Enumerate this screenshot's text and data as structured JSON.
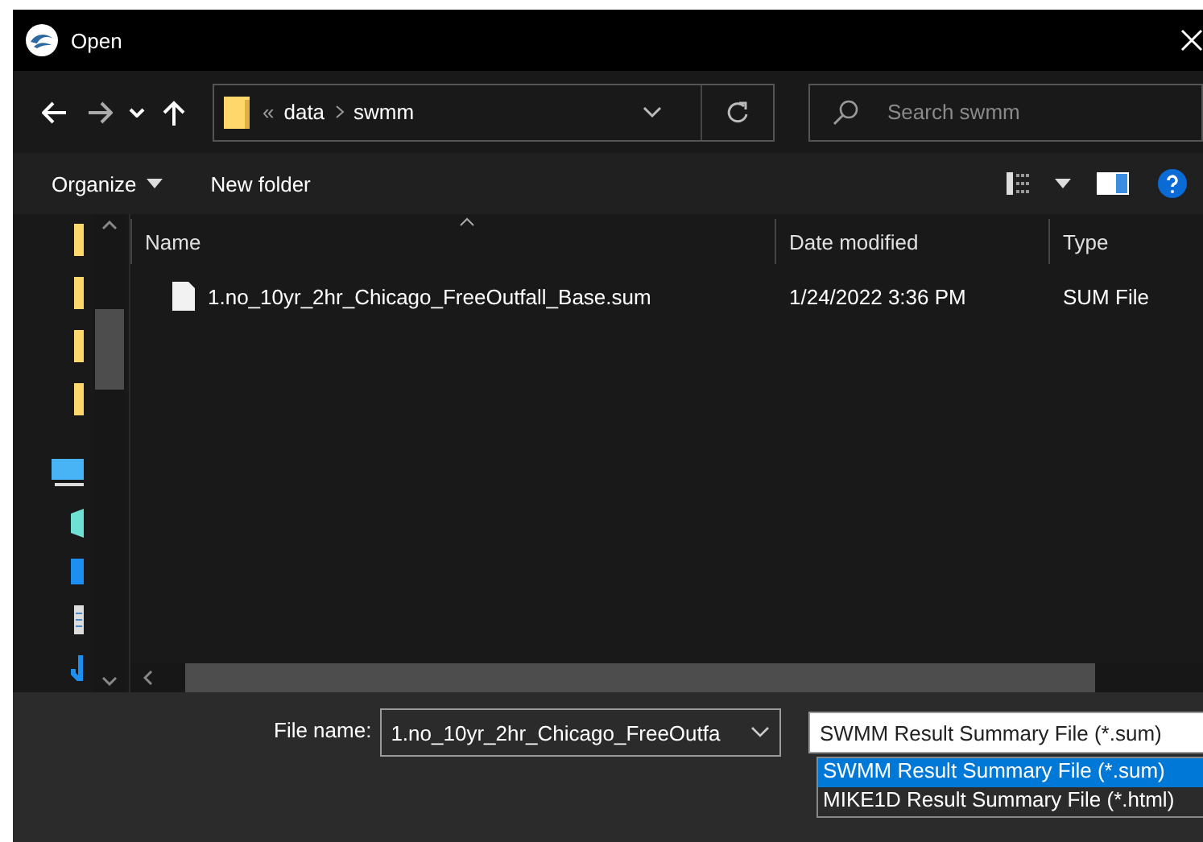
{
  "window": {
    "title": "Open"
  },
  "address": {
    "chevron": "«",
    "path": [
      "data",
      "swmm"
    ]
  },
  "search": {
    "placeholder": "Search swmm"
  },
  "toolbar": {
    "organize": "Organize",
    "new_folder": "New folder"
  },
  "table": {
    "columns": [
      "Name",
      "Date modified",
      "Type"
    ],
    "rows": [
      {
        "name": "1.no_10yr_2hr_Chicago_FreeOutfall_Base.sum",
        "date": "1/24/2022 3:36 PM",
        "type": "SUM File"
      }
    ]
  },
  "file_name": {
    "label": "File name:",
    "value": "1.no_10yr_2hr_Chicago_FreeOutfa"
  },
  "file_type": {
    "value": "SWMM Result Summary File (*.sum)",
    "options": [
      {
        "label": "SWMM Result Summary File (*.sum)",
        "selected": true
      },
      {
        "label": "MIKE1D Result Summary File (*.html)",
        "selected": false
      }
    ]
  }
}
